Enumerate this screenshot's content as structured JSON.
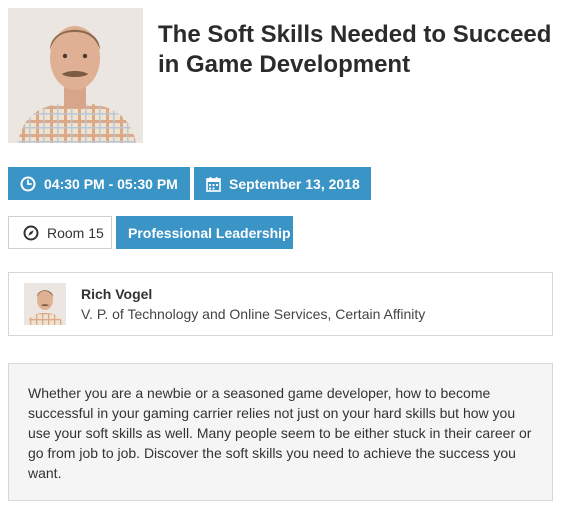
{
  "session": {
    "title": "The Soft Skills Needed to Succeed in Game Development",
    "time": "04:30 PM - 05:30 PM",
    "date": "September 13, 2018",
    "room": "Room 15",
    "track": "Professional Leadership"
  },
  "speaker": {
    "name": "Rich Vogel",
    "role": "V. P. of Technology and Online Services, Certain Affinity"
  },
  "description": "Whether you are a newbie or a seasoned game developer, how to become successful in your gaming carrier relies not just on your hard skills but how you use your soft skills as well. Many people seem to be either stuck in their career or go from job to job. Discover the soft skills you need to achieve the success you want.",
  "icons": {
    "time": "clock-icon",
    "date": "calendar-icon",
    "room": "compass-icon"
  },
  "colors": {
    "accent": "#3b94c6",
    "card_border": "#d7d7d7",
    "desc_bg": "#f5f5f5"
  }
}
